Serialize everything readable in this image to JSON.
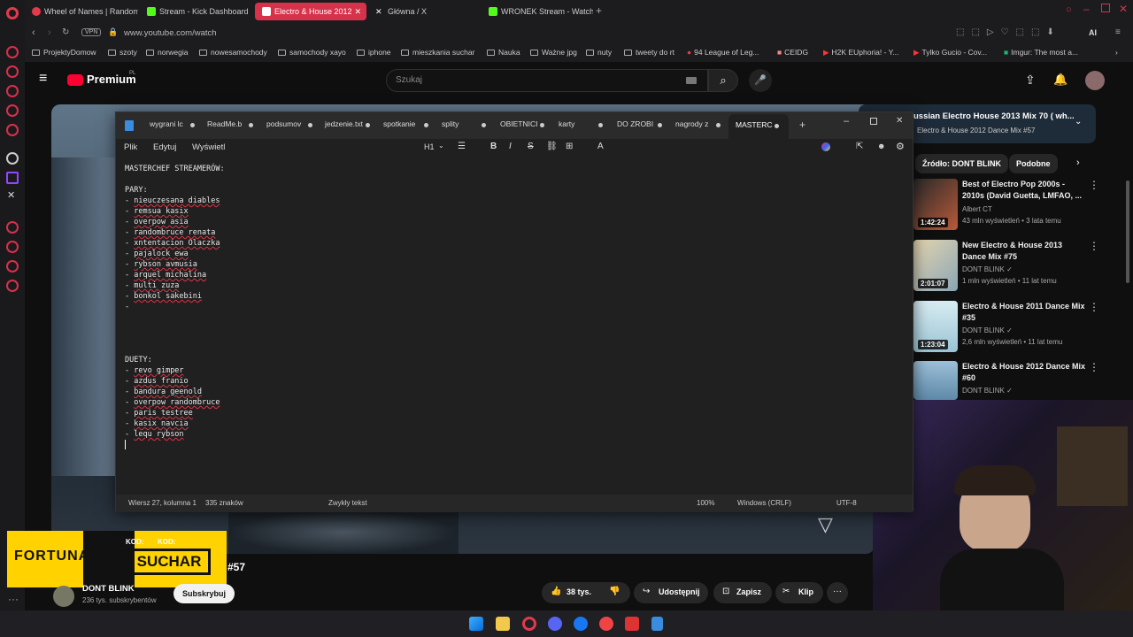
{
  "browser": {
    "tabs": [
      {
        "label": "Wheel of Names | Random",
        "color": "#e23a4c"
      },
      {
        "label": "Stream - Kick Dashboard",
        "color": "#53fc18"
      },
      {
        "label": "Electro & House 2012",
        "color": "#ff2f4b"
      },
      {
        "label": "Główna / X",
        "color": "#ffffff"
      },
      {
        "label": "WRONEK Stream - Watch",
        "color": "#53fc18"
      }
    ],
    "vpn_label": "VPN",
    "url": "www.youtube.com/watch",
    "ai_label": "AI",
    "bookmarks": [
      "ProjektyDomow",
      "szoty",
      "norwegia",
      "nowesamochody",
      "samochody xayo",
      "iphone",
      "mieszkania suchar",
      "Nauka",
      "Ważne jpg",
      "nuty",
      "tweety do rt",
      "94 League of Leg...",
      "CEIDG",
      "H2K EUphoria! - Y...",
      "Tylko Gucio - Cov...",
      "Imgur: The most a..."
    ]
  },
  "youtube": {
    "logo": "Premium",
    "logo_region": "PL",
    "search_placeholder": "Szukaj",
    "channel_name": "DONT BLINK",
    "subscribers": "236 tys. subskrybentów",
    "subscribe_label": "Subskrybuj",
    "title_suffix": "#57",
    "likes": "38 tys.",
    "share_label": "Udostępnij",
    "save_label": "Zapisz",
    "clip_label": "Klip",
    "playlist_title": "ussian Electro House 2013 Mix 70 ( wh...",
    "playlist_sub": "Electro & House 2012 Dance Mix #57",
    "chips": [
      "Źródło: DONT BLINK",
      "Podobne"
    ],
    "recommendations": [
      {
        "title": "Best of Electro Pop 2000s - 2010s (David Guetta, LMFAO, ...",
        "channel": "Albert CT",
        "meta": "43 mln wyświetleń • 3 lata temu",
        "duration": "1:42:24",
        "thumb": "#b85a3a"
      },
      {
        "title": "New Electro & House 2013 Dance Mix #75",
        "channel": "DONT BLINK",
        "meta": "1 mln wyświetleń • 11 lat temu",
        "duration": "2:01:07",
        "thumb": "#c9b98a"
      },
      {
        "title": "Electro & House 2011 Dance Mix #35",
        "channel": "DONT BLINK",
        "meta": "2,6 mln wyświetleń • 11 lat temu",
        "duration": "1:23:04",
        "thumb": "#9bc4d4"
      },
      {
        "title": "Electro & House 2012 Dance Mix #60",
        "channel": "DONT BLINK",
        "meta": "",
        "duration": "",
        "thumb": "#5e89a8"
      }
    ]
  },
  "ad": {
    "brand": "FORTUNA",
    "code_label": "KOD:",
    "code": "SUCHAR"
  },
  "notepad": {
    "tabs": [
      "wygrani lc",
      "ReadMe.b",
      "podsumov",
      "jedzenie.txt",
      "spotkanie",
      "splity",
      "OBIETNICI",
      "karty",
      "DO ZROBI",
      "nagrody z",
      "MASTERC"
    ],
    "menu": [
      "Plik",
      "Edytuj",
      "Wyświetl"
    ],
    "heading_label": "H1",
    "title_line": "MASTERCHEF STREAMERÓW:",
    "pary_header": "PARY:",
    "pary": [
      "nieuczesana diables",
      "remsua kasix",
      "overpow asia",
      "randombruce renata",
      "xntentacion Olaczka",
      "pajalock ewa",
      "rybson avmusia",
      "arquel michalina",
      "multi zuza",
      "bonkol sakebini"
    ],
    "duety_header": "DUETY:",
    "duety": [
      "revo gimper",
      "azdus franio",
      "bandura geenold",
      "overpow randombruce",
      "paris testree",
      "kasix navcia",
      "lequ rybson"
    ],
    "status": {
      "position": "Wiersz 27, kolumna 1",
      "chars": "335 znaków",
      "format": "Zwykły tekst",
      "zoom": "100%",
      "eol": "Windows (CRLF)",
      "encoding": "UTF-8"
    }
  }
}
